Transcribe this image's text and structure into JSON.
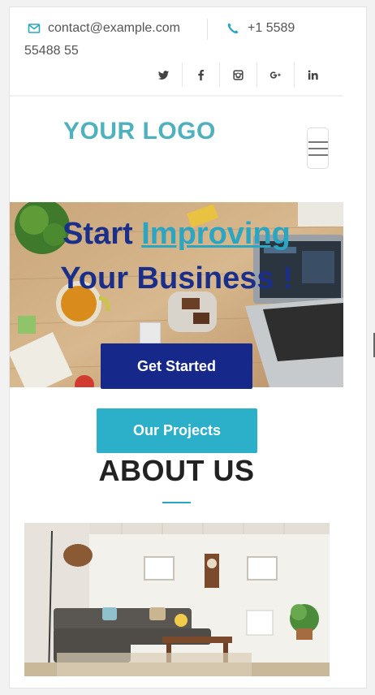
{
  "topbar": {
    "email": "contact@example.com",
    "phone_part1": "+1 5589",
    "phone_part2": "55488 55",
    "socials": [
      {
        "name": "twitter",
        "icon": "twitter-icon"
      },
      {
        "name": "facebook",
        "icon": "facebook-icon"
      },
      {
        "name": "instagram",
        "icon": "instagram-icon"
      },
      {
        "name": "google-plus",
        "icon": "google-plus-icon"
      },
      {
        "name": "linkedin",
        "icon": "linkedin-icon"
      }
    ]
  },
  "header": {
    "logo_text": "YOUR LOGO",
    "menu_icon": "hamburger-icon"
  },
  "hero": {
    "title_start": "Start ",
    "title_accent": "Improving",
    "title_line2": "Your Business !",
    "cta_label": "Get Started"
  },
  "projects_label": "Our Projects",
  "about": {
    "title": "ABOUT US"
  },
  "colors": {
    "accent": "#2aa5c2",
    "primary_dark": "#16298a",
    "logo": "#4fb0be"
  }
}
